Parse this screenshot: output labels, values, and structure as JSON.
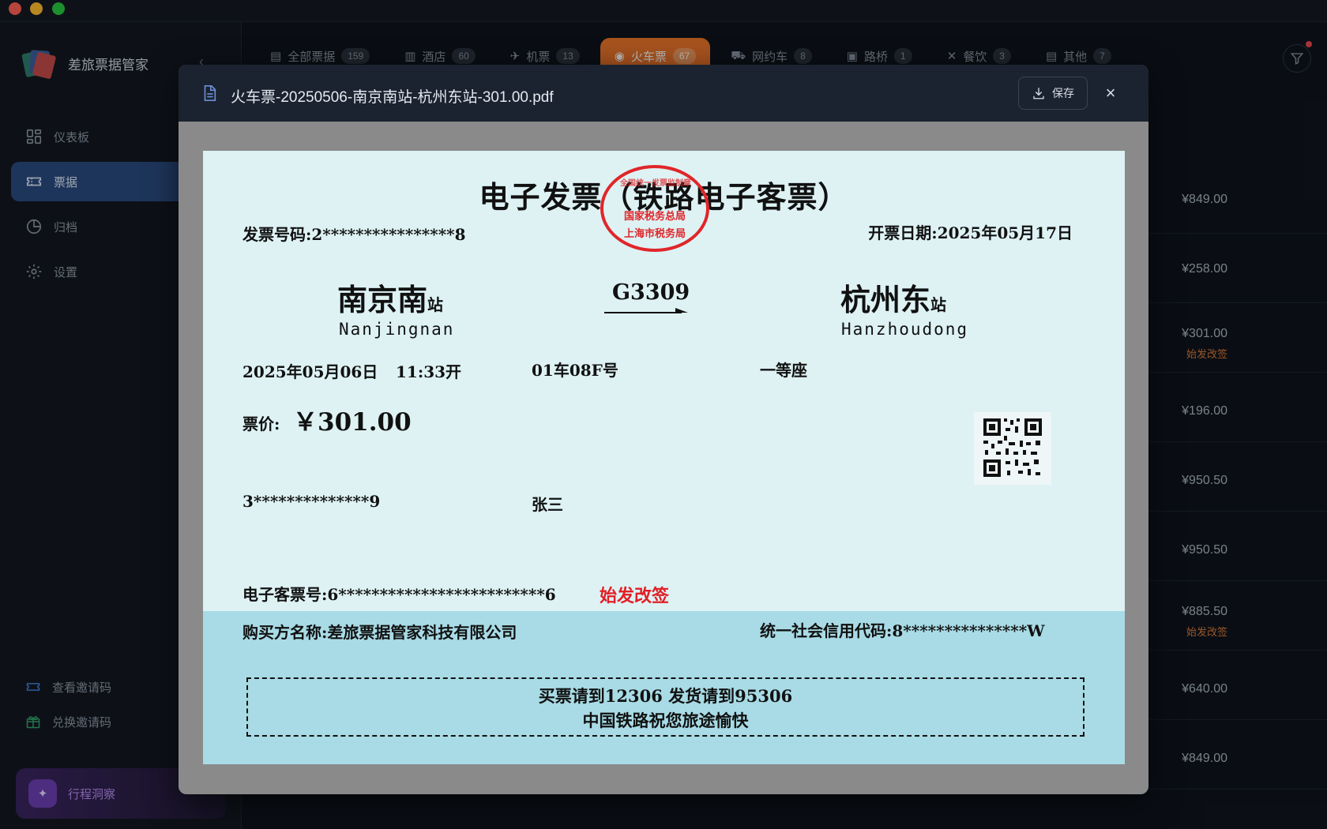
{
  "app": {
    "name": "差旅票据管家"
  },
  "sidebar": {
    "items": [
      {
        "label": "仪表板",
        "icon": "dashboard-icon"
      },
      {
        "label": "票据",
        "icon": "ticket-icon"
      },
      {
        "label": "归档",
        "icon": "archive-icon"
      },
      {
        "label": "设置",
        "icon": "gear-icon"
      }
    ],
    "bottom": [
      {
        "label": "查看邀请码",
        "icon": "ticket-icon"
      },
      {
        "label": "兑换邀请码",
        "icon": "gift-icon"
      }
    ],
    "insight_label": "行程洞察"
  },
  "tabs": [
    {
      "label": "全部票据",
      "count": "159"
    },
    {
      "label": "酒店",
      "count": "60"
    },
    {
      "label": "机票",
      "count": "13"
    },
    {
      "label": "火车票",
      "count": "67"
    },
    {
      "label": "网约车",
      "count": "8"
    },
    {
      "label": "路桥",
      "count": "1"
    },
    {
      "label": "餐饮",
      "count": "3"
    },
    {
      "label": "其他",
      "count": "7"
    }
  ],
  "list": [
    {
      "amount": "¥849.00",
      "note": ""
    },
    {
      "amount": "¥258.00",
      "note": ""
    },
    {
      "amount": "¥301.00",
      "note": "始发改签"
    },
    {
      "amount": "¥196.00",
      "note": ""
    },
    {
      "amount": "¥950.50",
      "note": ""
    },
    {
      "amount": "¥950.50",
      "note": ""
    },
    {
      "amount": "¥885.50",
      "note": "始发改签"
    },
    {
      "amount": "¥640.00",
      "note": ""
    },
    {
      "amount": "¥849.00",
      "note": ""
    }
  ],
  "modal": {
    "filename": "火车票-20250506-南京南站-杭州东站-301.00.pdf",
    "save_label": "保存",
    "close_label": "×"
  },
  "ticket": {
    "title": "电子发票（铁路电子客票）",
    "invoice_no": "发票号码:2****************8",
    "issue_date": "开票日期:2025年05月17日",
    "from_station": "南京南",
    "from_suffix": "站",
    "from_pinyin": "Nanjingnan",
    "train_no": "G3309",
    "to_station": "杭州东",
    "to_suffix": "站",
    "to_pinyin": "Hanzhoudong",
    "depart_date": "2025年05月06日",
    "depart_time": "11:33开",
    "seat_no": "01车08F号",
    "seat_class": "一等座",
    "price_label": "票价:",
    "price": "￥301.00",
    "id_no": "3**************9",
    "passenger": "张三",
    "eticket_no": "电子客票号:6*************************6",
    "change_mark": "始发改签",
    "buyer": "购买方名称:差旅票据管家科技有限公司",
    "credit_code": "统一社会信用代码:8***************W",
    "notice_line1": "买票请到12306 发货请到95306",
    "notice_line2": "中国铁路祝您旅途愉快",
    "stamp_line1": "国家税务总局",
    "stamp_line2": "上海市税务局",
    "stamp_arc": "全国统一发票监制章"
  }
}
